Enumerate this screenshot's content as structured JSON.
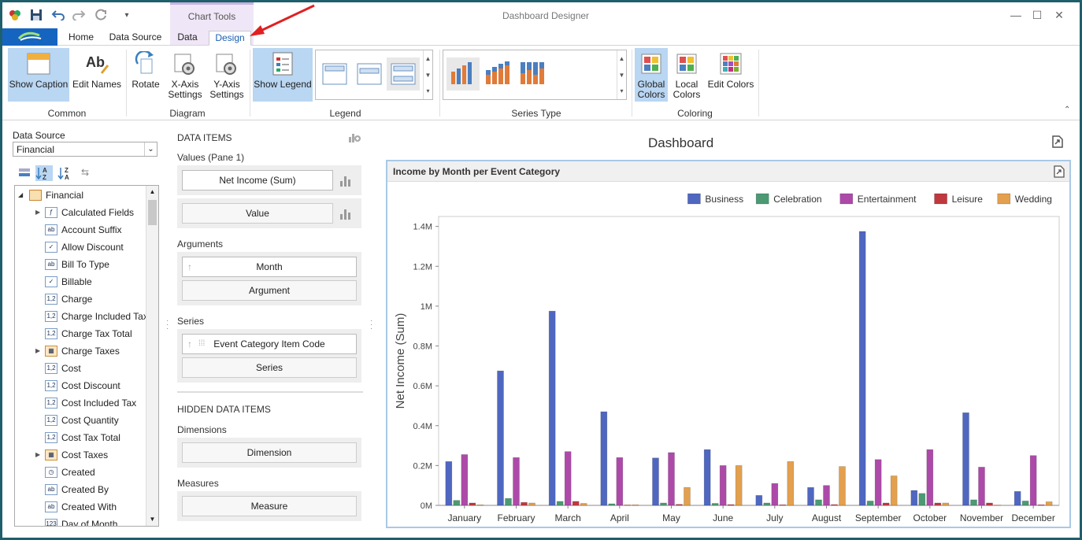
{
  "titlebar": {
    "title": "Dashboard Designer",
    "context_group": "Chart Tools"
  },
  "tabs": [
    {
      "label": "Home"
    },
    {
      "label": "Data Source"
    },
    {
      "label": "Data"
    },
    {
      "label": "Design",
      "active": true
    }
  ],
  "ribbon": {
    "common": {
      "label": "Common",
      "show_caption": "Show Caption",
      "edit_names": "Edit Names"
    },
    "diagram": {
      "label": "Diagram",
      "rotate": "Rotate",
      "x_axis_line1": "X-Axis",
      "x_axis_line2": "Settings",
      "y_axis_line1": "Y-Axis",
      "y_axis_line2": "Settings"
    },
    "legend": {
      "label": "Legend",
      "show_legend": "Show Legend"
    },
    "series_type": {
      "label": "Series Type"
    },
    "coloring": {
      "label": "Coloring",
      "global_line1": "Global",
      "global_line2": "Colors",
      "local_line1": "Local",
      "local_line2": "Colors",
      "edit_colors": "Edit Colors"
    }
  },
  "left_panel": {
    "data_source_label": "Data Source",
    "data_source_value": "Financial",
    "root": "Financial",
    "fields": [
      {
        "label": "Calculated Fields",
        "icon": "f",
        "expand": true
      },
      {
        "label": "Account Suffix",
        "icon": "ab"
      },
      {
        "label": "Allow Discount",
        "icon": "check"
      },
      {
        "label": "Bill To Type",
        "icon": "ab"
      },
      {
        "label": "Billable",
        "icon": "check"
      },
      {
        "label": "Charge",
        "icon": "1,2"
      },
      {
        "label": "Charge Included Tax",
        "icon": "1,2"
      },
      {
        "label": "Charge Tax Total",
        "icon": "1,2"
      },
      {
        "label": "Charge Taxes",
        "icon": "table",
        "expand": true
      },
      {
        "label": "Cost",
        "icon": "1,2"
      },
      {
        "label": "Cost Discount",
        "icon": "1,2"
      },
      {
        "label": "Cost Included Tax",
        "icon": "1,2"
      },
      {
        "label": "Cost Quantity",
        "icon": "1,2"
      },
      {
        "label": "Cost Tax Total",
        "icon": "1,2"
      },
      {
        "label": "Cost Taxes",
        "icon": "table",
        "expand": true
      },
      {
        "label": "Created",
        "icon": "clock"
      },
      {
        "label": "Created By",
        "icon": "ab"
      },
      {
        "label": "Created With",
        "icon": "ab"
      },
      {
        "label": "Day of Month",
        "icon": "123"
      }
    ]
  },
  "data_items": {
    "header": "DATA ITEMS",
    "values_label": "Values (Pane 1)",
    "values": [
      "Net Income (Sum)",
      "Value"
    ],
    "arguments_label": "Arguments",
    "arguments": [
      "Month",
      "Argument"
    ],
    "series_label": "Series",
    "series": [
      "Event Category Item Code",
      "Series"
    ],
    "hidden_header": "HIDDEN DATA ITEMS",
    "dimensions_label": "Dimensions",
    "dimension_placeholder": "Dimension",
    "measures_label": "Measures",
    "measure_placeholder": "Measure"
  },
  "dashboard": {
    "title": "Dashboard",
    "chart_caption": "Income by Month per Event Category"
  },
  "colors": {
    "Business": "#4f67c0",
    "Celebration": "#4c9a74",
    "Entertainment": "#ad4aa9",
    "Leisure": "#c0393f",
    "Wedding": "#e3a04e"
  },
  "chart_data": {
    "type": "bar",
    "title": "Income by Month per Event Category",
    "xlabel": "",
    "ylabel": "Net Income (Sum)",
    "ylim": [
      0,
      1450000
    ],
    "yticks": [
      0,
      200000,
      400000,
      600000,
      800000,
      1000000,
      1200000,
      1400000
    ],
    "ytick_labels": [
      "0M",
      "0.2M",
      "0.4M",
      "0.6M",
      "0.8M",
      "1M",
      "1.2M",
      "1.4M"
    ],
    "legend_position": "top-right",
    "grid": false,
    "categories": [
      "January",
      "February",
      "March",
      "April",
      "May",
      "June",
      "July",
      "August",
      "September",
      "October",
      "November",
      "December"
    ],
    "series": [
      {
        "name": "Business",
        "values": [
          220000,
          675000,
          975000,
          470000,
          238000,
          280000,
          50000,
          90000,
          1375000,
          75000,
          465000,
          70000
        ]
      },
      {
        "name": "Celebration",
        "values": [
          25000,
          35000,
          20000,
          8000,
          12000,
          10000,
          12000,
          28000,
          22000,
          60000,
          28000,
          22000
        ]
      },
      {
        "name": "Entertainment",
        "values": [
          255000,
          240000,
          270000,
          240000,
          265000,
          200000,
          110000,
          100000,
          230000,
          280000,
          192000,
          250000
        ]
      },
      {
        "name": "Leisure",
        "values": [
          12000,
          15000,
          20000,
          2000,
          5000,
          4000,
          3000,
          4000,
          12000,
          12000,
          12000,
          3000
        ]
      },
      {
        "name": "Wedding",
        "values": [
          3000,
          12000,
          10000,
          3000,
          90000,
          200000,
          220000,
          195000,
          148000,
          12000,
          2000,
          18000
        ]
      }
    ]
  }
}
